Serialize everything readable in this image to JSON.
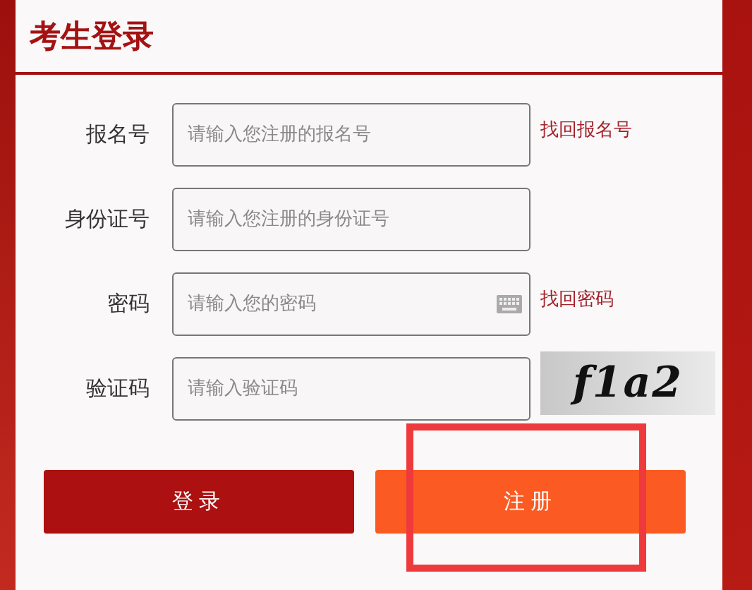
{
  "title": "考生登录",
  "fields": [
    {
      "kind": "text",
      "label": "报名号",
      "placeholder": "请输入您注册的报名号",
      "link": "找回报名号"
    },
    {
      "kind": "text",
      "label": "身份证号",
      "placeholder": "请输入您注册的身份证号"
    },
    {
      "kind": "password",
      "label": "密码",
      "placeholder": "请输入您的密码",
      "link": "找回密码"
    },
    {
      "kind": "captcha",
      "label": "验证码",
      "placeholder": "请输入验证码",
      "captcha": "f1a2"
    }
  ],
  "buttons": [
    {
      "kind": "primary",
      "label": "登录",
      "highlighted": false
    },
    {
      "kind": "secondary",
      "label": "注册",
      "highlighted": true
    }
  ]
}
